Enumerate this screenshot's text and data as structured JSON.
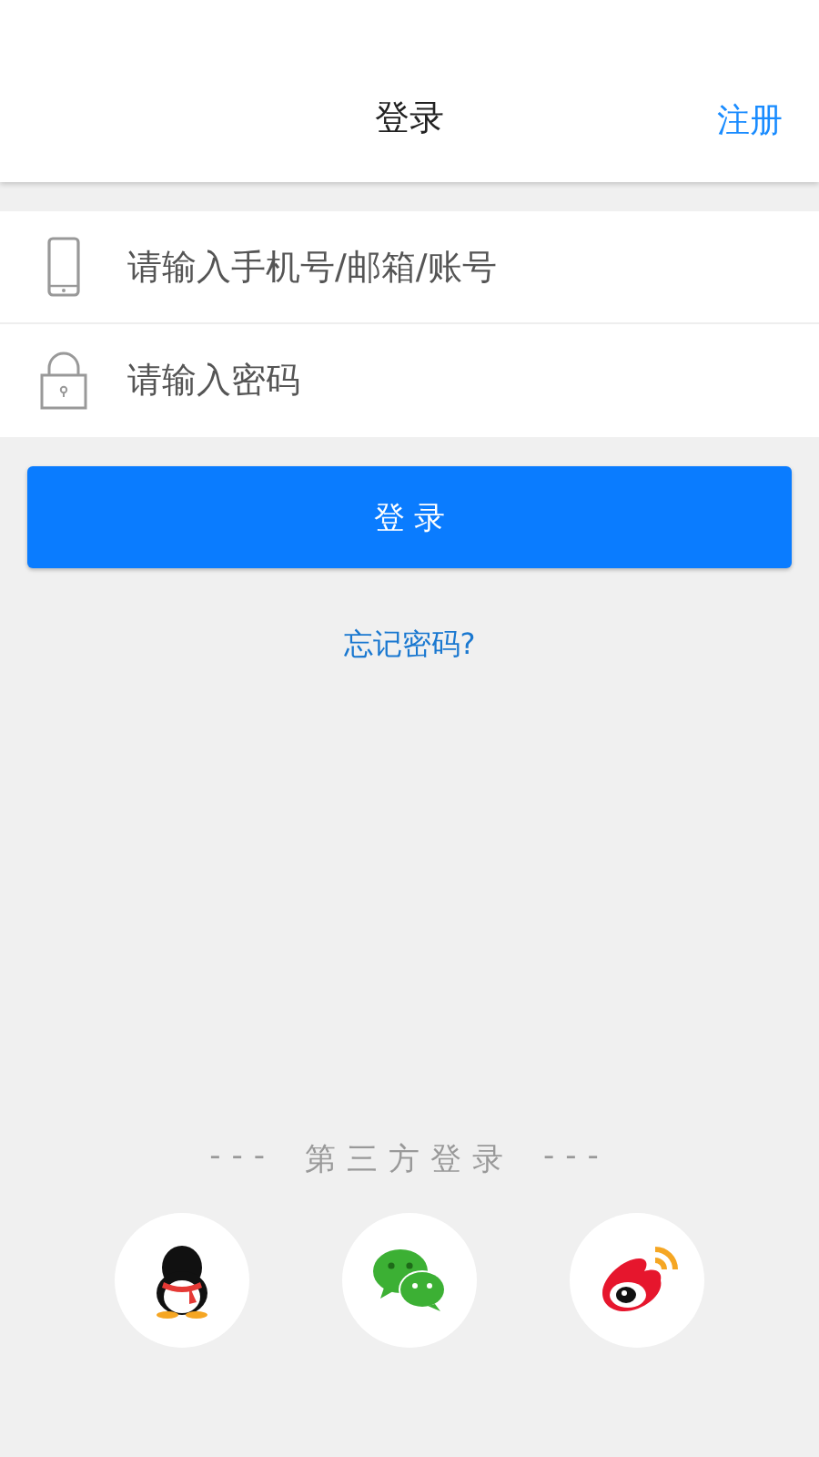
{
  "header": {
    "title": "登录",
    "register_link": "注册"
  },
  "fields": [
    {
      "kind": "phone",
      "placeholder": "请输入手机号/邮箱/账号"
    },
    {
      "kind": "password",
      "placeholder": "请输入密码"
    }
  ],
  "login_button": "登 录",
  "forgot_link": "忘记密码?",
  "third_party": {
    "title": "第三方登录",
    "dash_left": "---",
    "dash_right": "---",
    "options": [
      {
        "kind": "penguin"
      },
      {
        "kind": "chat"
      },
      {
        "kind": "eye"
      }
    ]
  }
}
